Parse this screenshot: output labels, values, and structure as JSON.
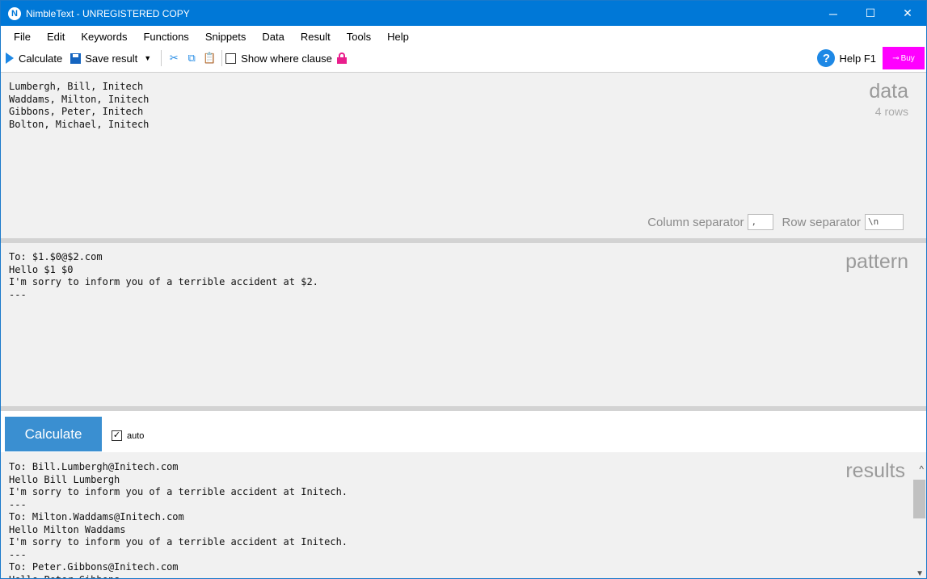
{
  "window": {
    "title": "NimbleText - UNREGISTERED COPY",
    "app_icon_letter": "N",
    "minimize": "─",
    "maximize": "☐",
    "close": "✕"
  },
  "menu": [
    "File",
    "Edit",
    "Keywords",
    "Functions",
    "Snippets",
    "Data",
    "Result",
    "Tools",
    "Help"
  ],
  "toolbar": {
    "calculate_label": "Calculate",
    "save_label": "Save result",
    "cut_glyph": "✂",
    "copy_glyph": "⧉",
    "paste_glyph": "📋",
    "show_where_label": "Show where clause",
    "help_label": "Help F1",
    "help_glyph": "?",
    "buy_label": "Buy",
    "buy_key_glyph": "⊸"
  },
  "data_panel": {
    "text": "Lumbergh, Bill, Initech\nWaddams, Milton, Initech\nGibbons, Peter, Initech\nBolton, Michael, Initech",
    "label": "data",
    "row_count": "4 rows",
    "column_separator_label": "Column separator",
    "column_separator_value": ",",
    "row_separator_label": "Row separator",
    "row_separator_value": "\\n"
  },
  "pattern_panel": {
    "text": "To: $1.$0@$2.com\nHello $1 $0\nI'm sorry to inform you of a terrible accident at $2.\n---",
    "label": "pattern"
  },
  "calc_bar": {
    "button_label": "Calculate",
    "auto_label": "auto",
    "auto_checked": "✓"
  },
  "results_panel": {
    "text": "To: Bill.Lumbergh@Initech.com\nHello Bill Lumbergh\nI'm sorry to inform you of a terrible accident at Initech.\n---\nTo: Milton.Waddams@Initech.com\nHello Milton Waddams\nI'm sorry to inform you of a terrible accident at Initech.\n---\nTo: Peter.Gibbons@Initech.com\nHello Peter Gibbons",
    "label": "results",
    "collapse_glyph": "^",
    "scroll_down_glyph": "▼"
  },
  "colors": {
    "titlebar": "#0078d7",
    "accent": "#1e88e5",
    "buy": "#ff00ff",
    "calculate_button": "#3a8fd1",
    "panel_bg": "#f1f1f1"
  }
}
